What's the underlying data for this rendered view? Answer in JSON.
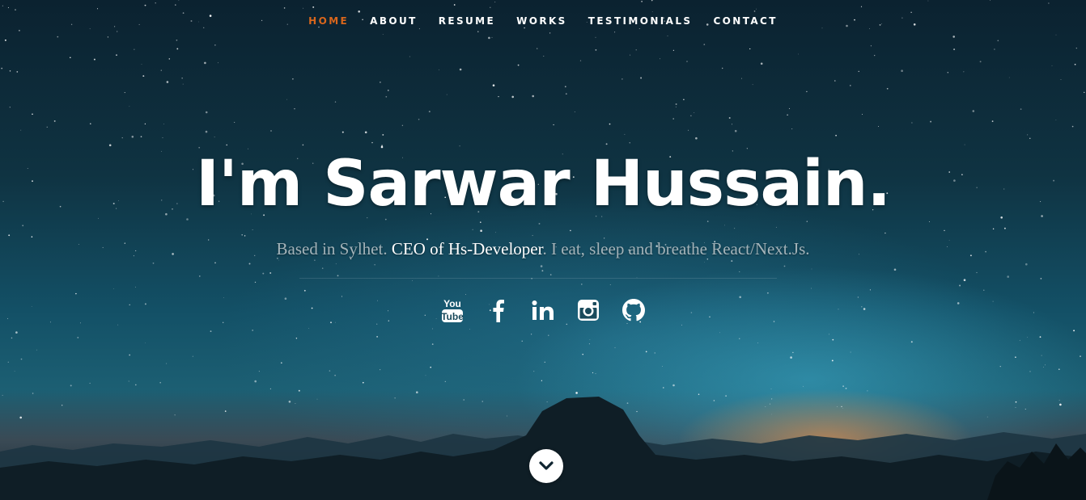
{
  "nav": {
    "items": [
      {
        "label": "HOME",
        "active": true
      },
      {
        "label": "ABOUT",
        "active": false
      },
      {
        "label": "RESUME",
        "active": false
      },
      {
        "label": "WORKS",
        "active": false
      },
      {
        "label": "TESTIMONIALS",
        "active": false
      },
      {
        "label": "CONTACT",
        "active": false
      }
    ],
    "active_color": "#d9661c"
  },
  "hero": {
    "title": "I'm Sarwar Hussain.",
    "tagline_before": "Based in Sylhet. ",
    "tagline_highlight": "CEO of Hs-Developer",
    "tagline_after": ". I eat, sleep and breathe React/Next.Js."
  },
  "social": [
    {
      "name": "youtube-icon",
      "label": "You Tube"
    },
    {
      "name": "facebook-icon",
      "label": "f"
    },
    {
      "name": "linkedin-icon",
      "label": "in"
    },
    {
      "name": "instagram-icon",
      "label": ""
    },
    {
      "name": "github-icon",
      "label": ""
    }
  ],
  "scroll": {
    "icon": "chevron-down-icon"
  }
}
